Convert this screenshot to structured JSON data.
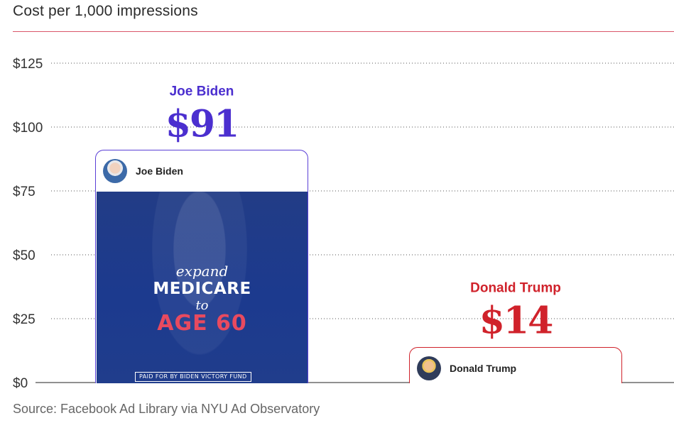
{
  "title": "Cost per 1,000 impressions",
  "source": "Source: Facebook Ad Library via NYU Ad Observatory",
  "colors": {
    "biden": "#4b2fcf",
    "trump": "#d0222b",
    "title_rule": "#d9576a",
    "gridline": "#555555",
    "axis_text": "#333333"
  },
  "chart_data": {
    "type": "bar",
    "title": "Cost per 1,000 impressions",
    "categories": [
      "Joe Biden",
      "Donald Trump"
    ],
    "values": [
      91,
      14
    ],
    "value_labels": [
      "$91",
      "$14"
    ],
    "ylim": [
      0,
      125
    ],
    "yticks": [
      0,
      25,
      50,
      75,
      100,
      125
    ],
    "ytick_labels": [
      "$0",
      "$25",
      "$50",
      "$75",
      "$100",
      "$125"
    ],
    "grid": true,
    "legend": "none"
  },
  "cards": {
    "biden": {
      "name": "Joe Biden",
      "ad_line1": "expand",
      "ad_line2": "MEDICARE",
      "ad_line3": "to",
      "ad_line4": "AGE 60",
      "ad_disclaimer": "PAID FOR BY BIDEN VICTORY FUND"
    },
    "trump": {
      "name": "Donald Trump"
    }
  }
}
